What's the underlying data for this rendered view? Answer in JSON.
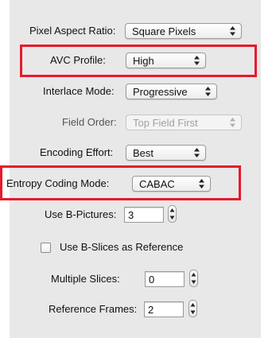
{
  "settings": {
    "pixel_aspect_ratio": {
      "label": "Pixel Aspect Ratio:",
      "value": "Square Pixels"
    },
    "avc_profile": {
      "label": "AVC Profile:",
      "value": "High"
    },
    "interlace_mode": {
      "label": "Interlace Mode:",
      "value": "Progressive"
    },
    "field_order": {
      "label": "Field Order:",
      "value": "Top Field First",
      "enabled": false
    },
    "encoding_effort": {
      "label": "Encoding Effort:",
      "value": "Best"
    },
    "entropy_coding_mode": {
      "label": "Entropy Coding Mode:",
      "value": "CABAC"
    },
    "use_b_pictures": {
      "label": "Use B-Pictures:",
      "value": "3"
    },
    "use_b_slices_as_reference": {
      "label": "Use B-Slices as Reference",
      "checked": false
    },
    "multiple_slices": {
      "label": "Multiple Slices:",
      "value": "0"
    },
    "reference_frames": {
      "label": "Reference Frames:",
      "value": "2"
    }
  },
  "colors": {
    "panel_background": "#e8e8e8",
    "highlight_border": "#e8192c"
  },
  "icons": {
    "popup_arrows": "up-down-arrows-icon",
    "stepper": "stepper-arrows-icon"
  }
}
